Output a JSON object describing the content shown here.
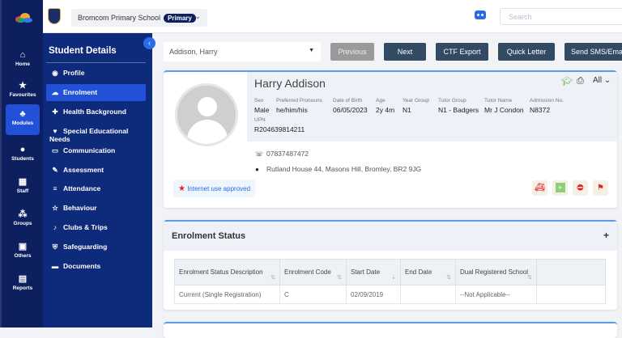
{
  "rail": {
    "items": [
      {
        "label": "Home",
        "icon": "home-icon"
      },
      {
        "label": "Favourites",
        "icon": "star-icon"
      },
      {
        "label": "Modules",
        "icon": "modules-icon",
        "active": true
      },
      {
        "label": "Students",
        "icon": "student-icon"
      },
      {
        "label": "Staff",
        "icon": "staff-icon"
      },
      {
        "label": "Groups",
        "icon": "groups-icon"
      },
      {
        "label": "Others",
        "icon": "others-icon"
      },
      {
        "label": "Reports",
        "icon": "report-icon"
      }
    ]
  },
  "topbar": {
    "school": "Bromcom Primary School",
    "school_badge": "Primary",
    "search_placeholder": "Search"
  },
  "sidebar": {
    "title": "Student Details",
    "items": [
      {
        "label": "Profile"
      },
      {
        "label": "Enrolment",
        "active": true
      },
      {
        "label": "Health Background"
      },
      {
        "label": "Special Educational Needs"
      },
      {
        "label": "Communication"
      },
      {
        "label": "Assessment"
      },
      {
        "label": "Attendance"
      },
      {
        "label": "Behaviour"
      },
      {
        "label": "Clubs & Trips"
      },
      {
        "label": "Safeguarding"
      },
      {
        "label": "Documents"
      }
    ]
  },
  "toolbar": {
    "student": "Addison, Harry",
    "previous": "Previous",
    "next": "Next",
    "ctf": "CTF Export",
    "quick_letter": "Quick Letter",
    "send": "Send SMS/Email"
  },
  "student": {
    "name": "Harry Addison",
    "view": "All",
    "fields": [
      {
        "label": "Sex",
        "value": "Male"
      },
      {
        "label": "Preferred Pronouns",
        "value": "he/him/his"
      },
      {
        "label": "Date of Birth",
        "value": "06/05/2023"
      },
      {
        "label": "Age",
        "value": "2y 4m"
      },
      {
        "label": "Year Group",
        "value": "N1"
      },
      {
        "label": "Tutor Group",
        "value": "N1 - Badgers"
      },
      {
        "label": "Tutor Name",
        "value": "Mr J Condon"
      },
      {
        "label": "Admission No.",
        "value": "N8372"
      }
    ],
    "upn_label": "UPN",
    "upn": "R204639814211",
    "phone": "07837487472",
    "address": "Rutland House 44, Masons Hill, Bromley, BR2 9JG",
    "internet": "Internet use approved"
  },
  "enrolment": {
    "title": "Enrolment Status",
    "columns": [
      "Enrolment Status Description",
      "Enrolment Code",
      "Start Date",
      "End Date",
      "Dual Registered School",
      ""
    ],
    "rows": [
      [
        "Current (Single Registration)",
        "C",
        "02/09/2019",
        "",
        "--Not Applicable--",
        ""
      ]
    ]
  },
  "colors": {
    "rail": "#0d1f5e",
    "sidebar": "#0e2a7a",
    "accent": "#2251d8",
    "button": "#334a63"
  }
}
